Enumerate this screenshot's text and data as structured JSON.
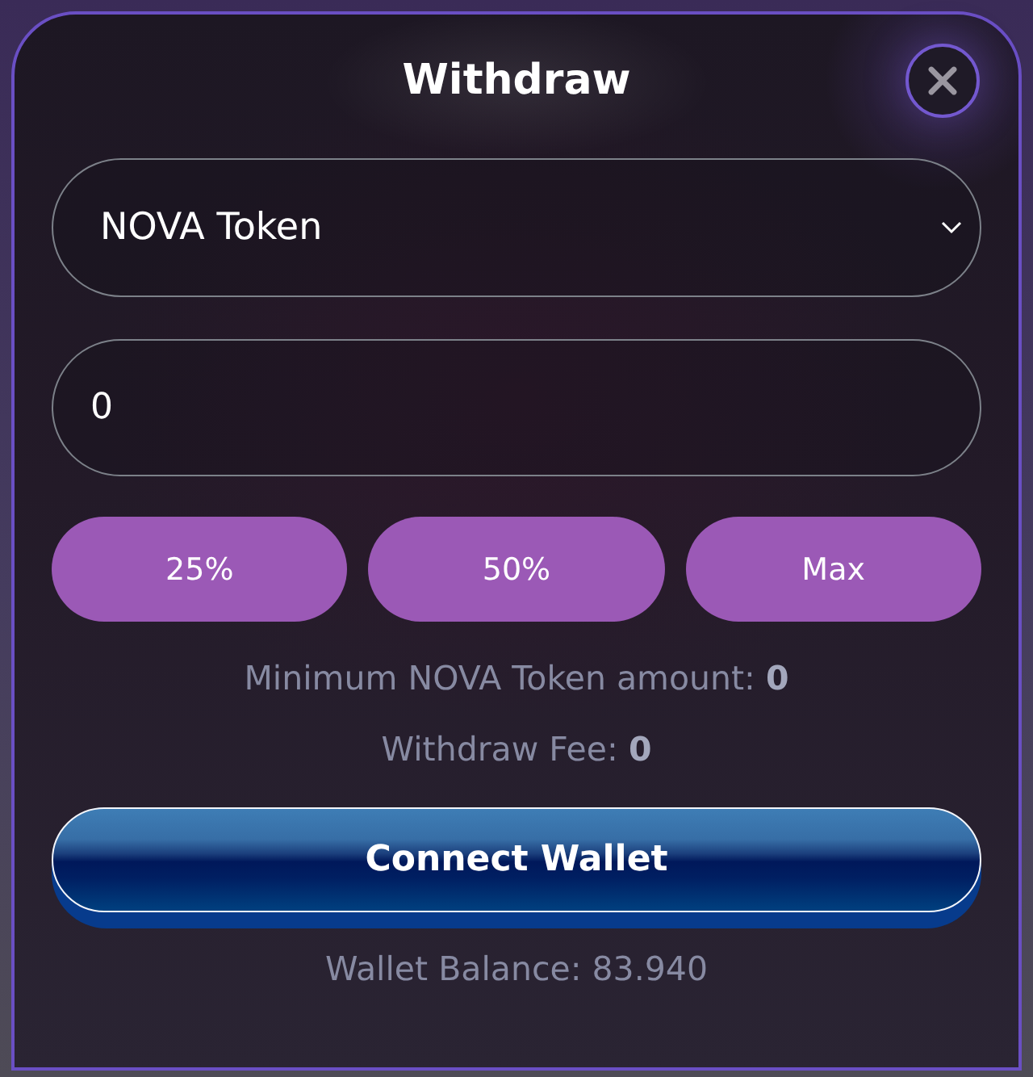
{
  "dialog": {
    "title": "Withdraw"
  },
  "token_select": {
    "value": "NOVA Token"
  },
  "amount_field": {
    "value": "0"
  },
  "quick_amounts": [
    {
      "label": "25%"
    },
    {
      "label": "50%"
    },
    {
      "label": "Max"
    }
  ],
  "minimum_amount": "Minimum NOVA Token amount: **0**",
  "withdraw_fee": "Withdraw Fee: **0**",
  "connect_button": {
    "label": "Connect Wallet"
  },
  "wallet_balance": "Wallet Balance: 83.940"
}
